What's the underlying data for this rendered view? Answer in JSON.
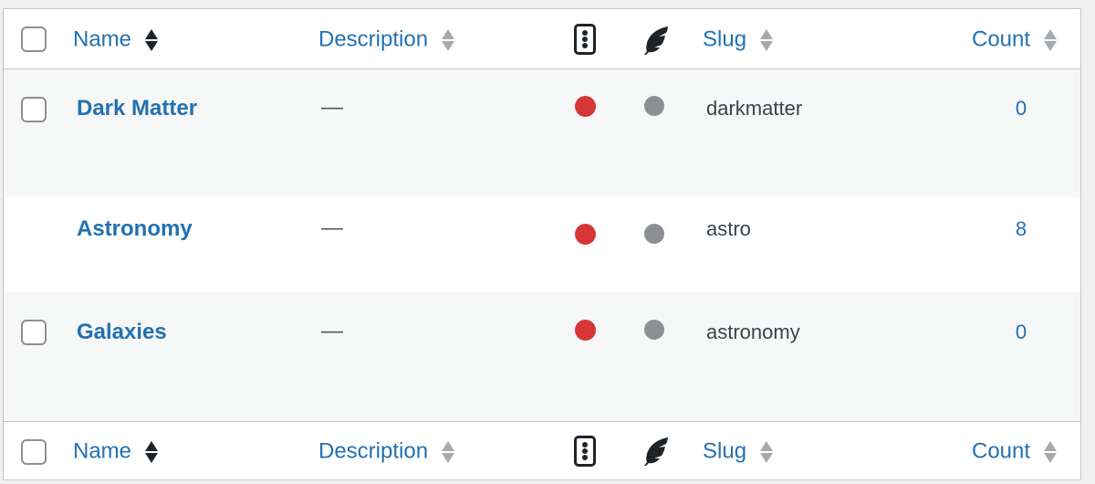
{
  "columns": {
    "name": "Name",
    "description": "Description",
    "slug": "Slug",
    "count": "Count",
    "status_icon": "traffic-light-icon",
    "feather_icon": "feather-icon"
  },
  "colors": {
    "link": "#2271b1",
    "status_red": "#d63638",
    "status_grey": "#8c8f94",
    "row_alt": "#f6f7f7"
  },
  "rows": [
    {
      "name": "Dark Matter",
      "description": "—",
      "slug": "darkmatter",
      "count": "0",
      "has_checkbox": true,
      "status": "red",
      "indexing": "grey"
    },
    {
      "name": "Astronomy",
      "description": "—",
      "slug": "astro",
      "count": "8",
      "has_checkbox": false,
      "status": "red",
      "indexing": "grey"
    },
    {
      "name": "Galaxies",
      "description": "—",
      "slug": "astronomy",
      "count": "0",
      "has_checkbox": true,
      "status": "red",
      "indexing": "grey"
    }
  ]
}
